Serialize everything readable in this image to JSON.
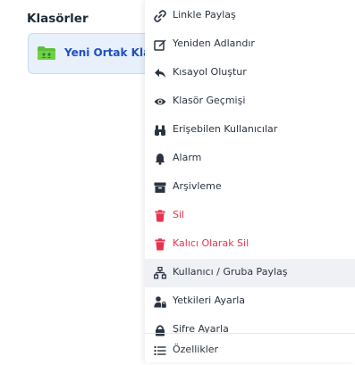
{
  "panel": {
    "title": "Klasörler",
    "folder": {
      "name": "Yeni Ortak Klas",
      "icon": "shared-folder-icon",
      "color": "#5bbf3a"
    }
  },
  "menu": {
    "items": [
      {
        "label": "Linkle Paylaş",
        "icon": "link-icon"
      },
      {
        "label": "Yeniden Adlandır",
        "icon": "edit-icon"
      },
      {
        "label": "Kısayol Oluştur",
        "icon": "shortcut-icon"
      },
      {
        "label": "Klasör Geçmişi",
        "icon": "eye-icon"
      },
      {
        "label": "Erişebilen Kullanıcılar",
        "icon": "binoculars-icon"
      },
      {
        "label": "Alarm",
        "icon": "bell-icon"
      },
      {
        "label": "Arşivleme",
        "icon": "archive-icon"
      },
      {
        "label": "Sil",
        "icon": "trash-icon"
      },
      {
        "label": "Kalıcı Olarak Sil",
        "icon": "trash-icon"
      },
      {
        "label": "Kullanıcı / Gruba Paylaş",
        "icon": "network-icon"
      },
      {
        "label": "Yetkileri Ayarla",
        "icon": "user-lock-icon"
      },
      {
        "label": "Şifre Ayarla",
        "icon": "lock-icon"
      },
      {
        "label": "Özellikler",
        "icon": "list-icon"
      }
    ],
    "danger_color": "#e8334f",
    "text_color": "#2b3340"
  }
}
